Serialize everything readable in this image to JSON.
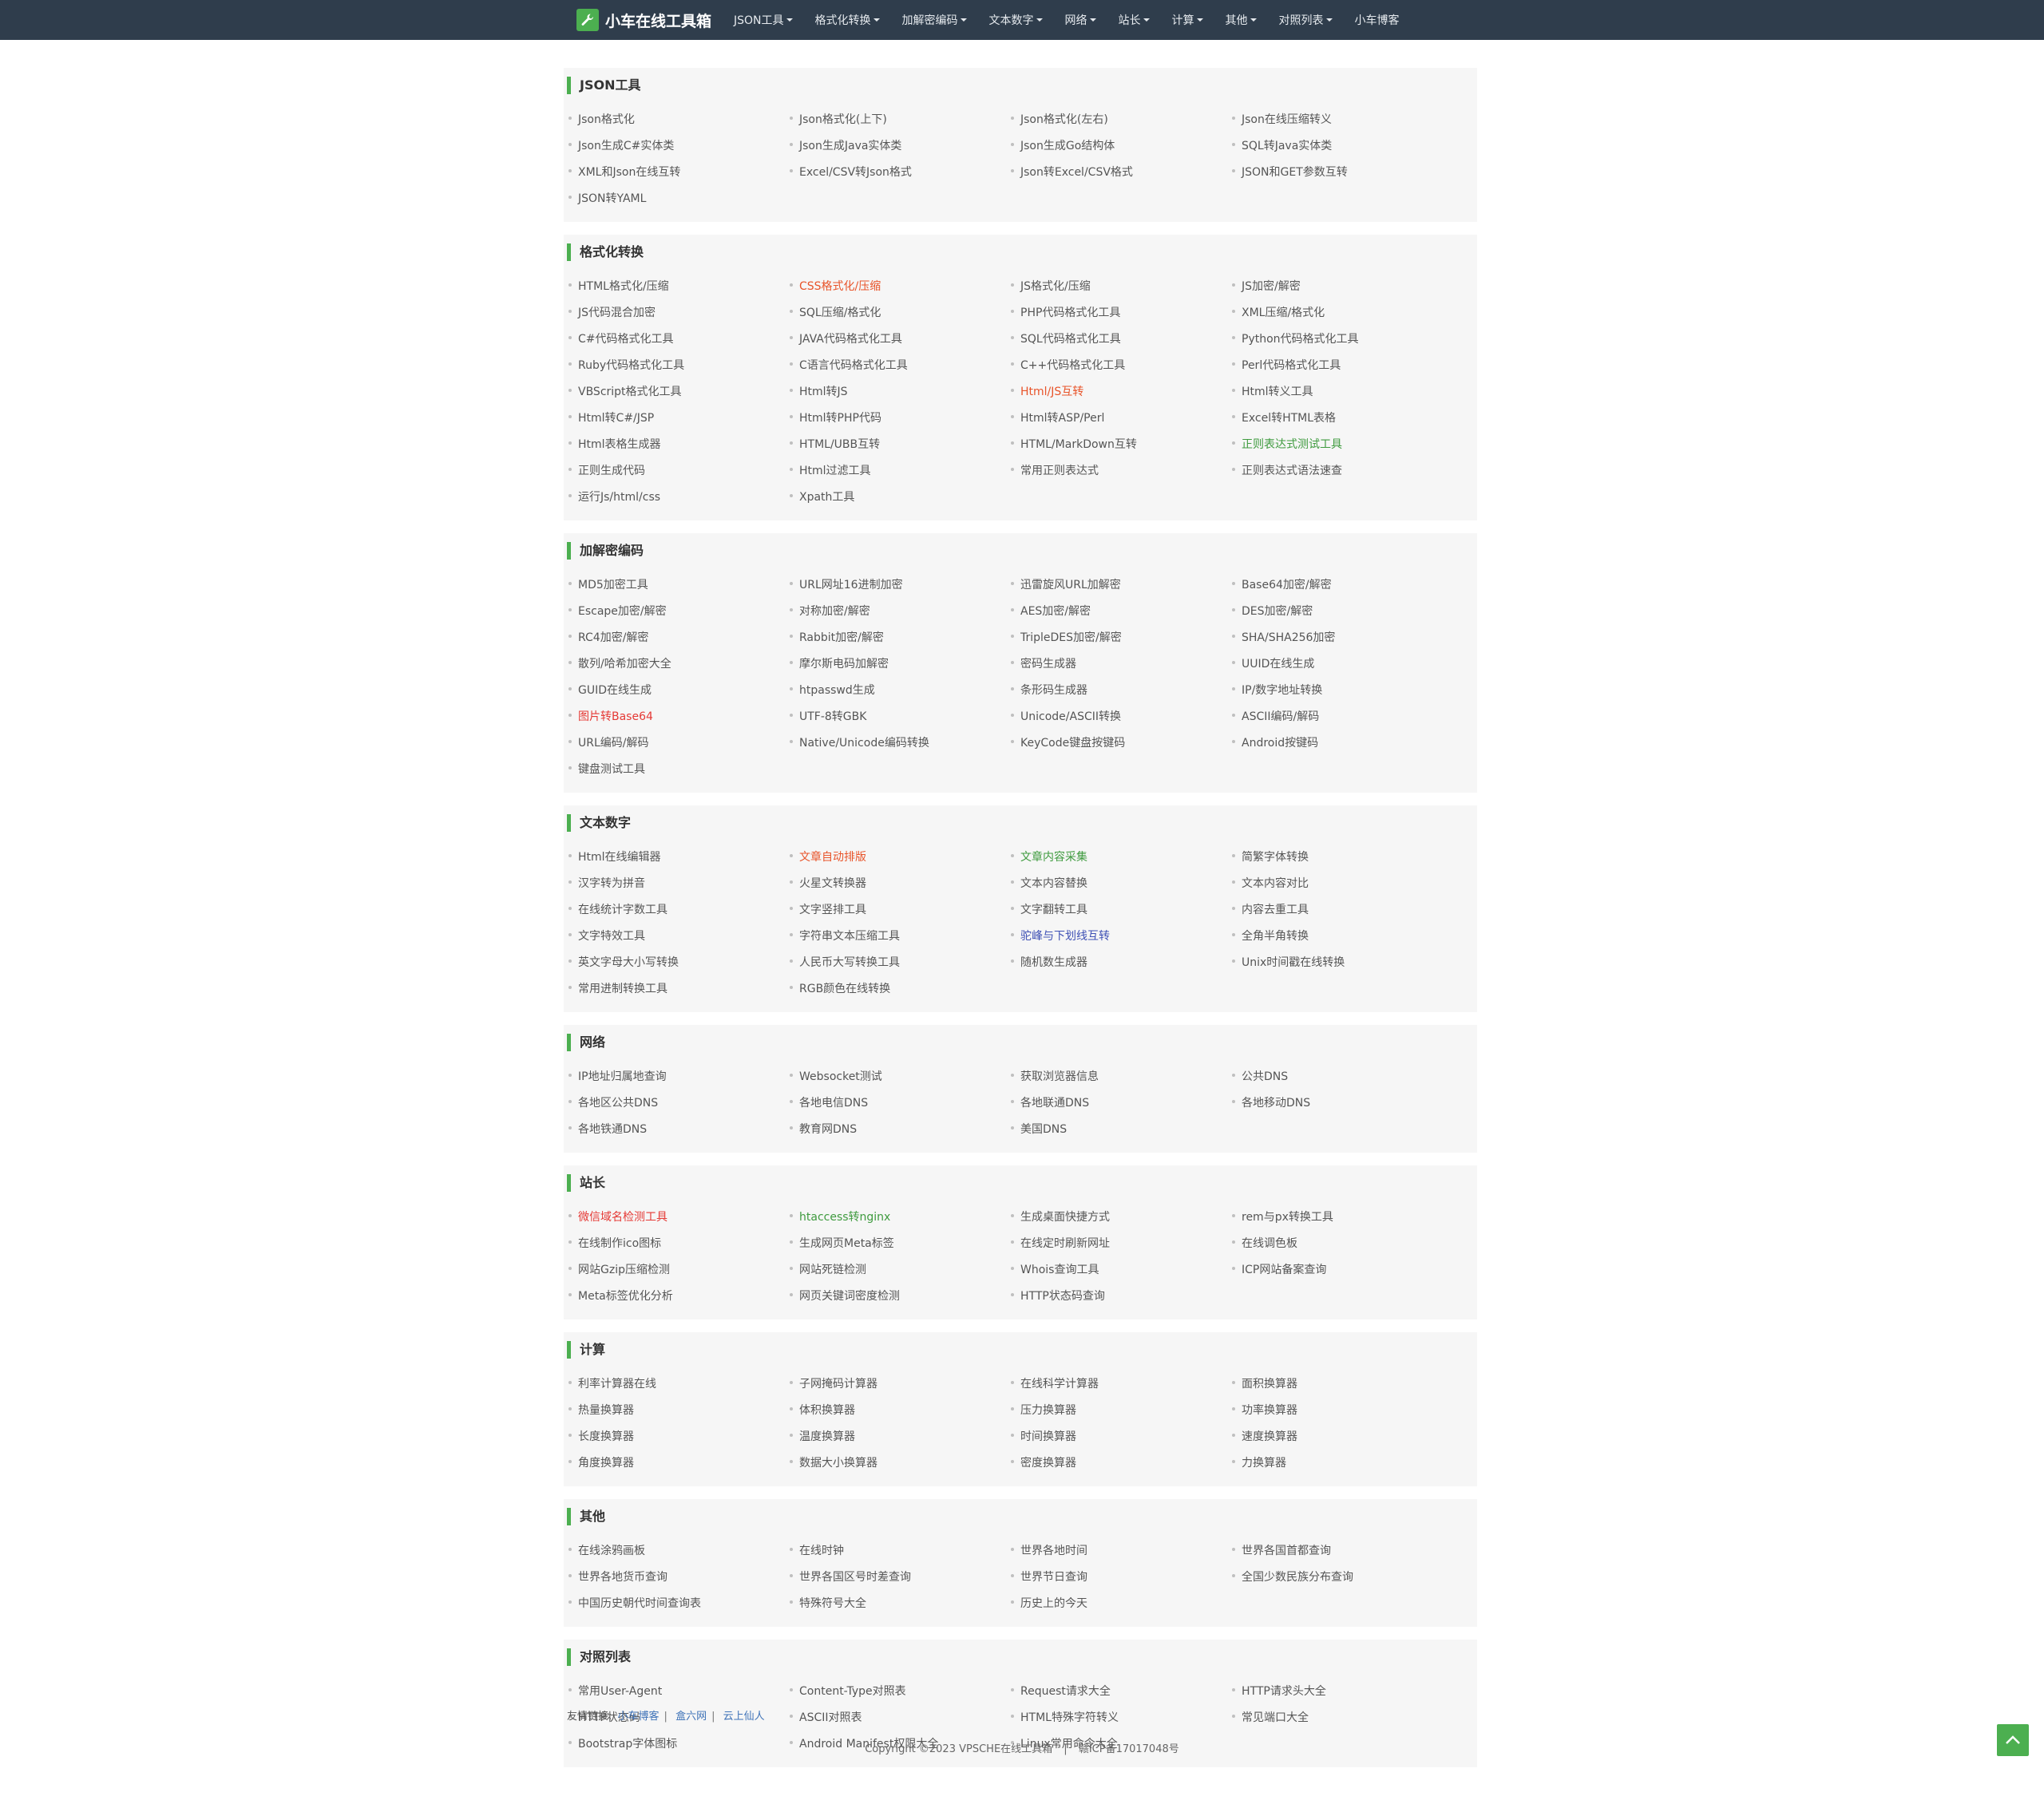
{
  "brand": {
    "name": "小车在线工具箱",
    "logo_icon": "wrench-icon"
  },
  "nav": [
    {
      "label": "JSON工具",
      "dropdown": true
    },
    {
      "label": "格式化转换",
      "dropdown": true
    },
    {
      "label": "加解密编码",
      "dropdown": true
    },
    {
      "label": "文本数字",
      "dropdown": true
    },
    {
      "label": "网络",
      "dropdown": true
    },
    {
      "label": "站长",
      "dropdown": true
    },
    {
      "label": "计算",
      "dropdown": true
    },
    {
      "label": "其他",
      "dropdown": true
    },
    {
      "label": "对照列表",
      "dropdown": true
    },
    {
      "label": "小车博客",
      "dropdown": false
    }
  ],
  "sections": [
    {
      "id": "json",
      "title": "JSON工具",
      "items": [
        {
          "label": "Json格式化"
        },
        {
          "label": "Json格式化(上下)"
        },
        {
          "label": "Json格式化(左右)"
        },
        {
          "label": "Json在线压缩转义"
        },
        {
          "label": "Json生成C#实体类"
        },
        {
          "label": "Json生成Java实体类"
        },
        {
          "label": "Json生成Go结构体"
        },
        {
          "label": "SQL转Java实体类"
        },
        {
          "label": "XML和Json在线互转"
        },
        {
          "label": "Excel/CSV转Json格式"
        },
        {
          "label": "Json转Excel/CSV格式"
        },
        {
          "label": "JSON和GET参数互转"
        },
        {
          "label": "JSON转YAML"
        }
      ]
    },
    {
      "id": "format",
      "title": "格式化转换",
      "items": [
        {
          "label": "HTML格式化/压缩"
        },
        {
          "label": "CSS格式化/压缩",
          "color": "orange"
        },
        {
          "label": "JS格式化/压缩"
        },
        {
          "label": "JS加密/解密"
        },
        {
          "label": "JS代码混合加密"
        },
        {
          "label": "SQL压缩/格式化"
        },
        {
          "label": "PHP代码格式化工具"
        },
        {
          "label": "XML压缩/格式化"
        },
        {
          "label": "C#代码格式化工具"
        },
        {
          "label": "JAVA代码格式化工具"
        },
        {
          "label": "SQL代码格式化工具"
        },
        {
          "label": "Python代码格式化工具"
        },
        {
          "label": "Ruby代码格式化工具"
        },
        {
          "label": "C语言代码格式化工具"
        },
        {
          "label": "C++代码格式化工具"
        },
        {
          "label": "Perl代码格式化工具"
        },
        {
          "label": "VBScript格式化工具"
        },
        {
          "label": "Html转JS"
        },
        {
          "label": "Html/JS互转",
          "color": "orange"
        },
        {
          "label": "Html转义工具"
        },
        {
          "label": "Html转C#/JSP"
        },
        {
          "label": "Html转PHP代码"
        },
        {
          "label": "Html转ASP/Perl"
        },
        {
          "label": "Excel转HTML表格"
        },
        {
          "label": "Html表格生成器"
        },
        {
          "label": "HTML/UBB互转"
        },
        {
          "label": "HTML/MarkDown互转"
        },
        {
          "label": "正则表达式测试工具",
          "color": "green"
        },
        {
          "label": "正则生成代码"
        },
        {
          "label": "Html过滤工具"
        },
        {
          "label": "常用正则表达式"
        },
        {
          "label": "正则表达式语法速查"
        },
        {
          "label": "运行Js/html/css"
        },
        {
          "label": "Xpath工具"
        }
      ]
    },
    {
      "id": "crypto",
      "title": "加解密编码",
      "items": [
        {
          "label": "MD5加密工具"
        },
        {
          "label": "URL网址16进制加密"
        },
        {
          "label": "迅雷旋风URL加解密"
        },
        {
          "label": "Base64加密/解密"
        },
        {
          "label": "Escape加密/解密"
        },
        {
          "label": "对称加密/解密"
        },
        {
          "label": "AES加密/解密"
        },
        {
          "label": "DES加密/解密"
        },
        {
          "label": "RC4加密/解密"
        },
        {
          "label": "Rabbit加密/解密"
        },
        {
          "label": "TripleDES加密/解密"
        },
        {
          "label": "SHA/SHA256加密"
        },
        {
          "label": "散列/哈希加密大全"
        },
        {
          "label": "摩尔斯电码加解密"
        },
        {
          "label": "密码生成器"
        },
        {
          "label": "UUID在线生成"
        },
        {
          "label": "GUID在线生成"
        },
        {
          "label": "htpasswd生成"
        },
        {
          "label": "条形码生成器"
        },
        {
          "label": "IP/数字地址转换"
        },
        {
          "label": "图片转Base64",
          "color": "red"
        },
        {
          "label": "UTF-8转GBK"
        },
        {
          "label": "Unicode/ASCII转换"
        },
        {
          "label": "ASCII编码/解码"
        },
        {
          "label": "URL编码/解码"
        },
        {
          "label": "Native/Unicode编码转换"
        },
        {
          "label": "KeyCode键盘按键码"
        },
        {
          "label": "Android按键码"
        },
        {
          "label": "键盘测试工具"
        }
      ]
    },
    {
      "id": "text",
      "title": "文本数字",
      "items": [
        {
          "label": "Html在线编辑器"
        },
        {
          "label": "文章自动排版",
          "color": "orange"
        },
        {
          "label": "文章内容采集",
          "color": "green"
        },
        {
          "label": "简繁字体转换"
        },
        {
          "label": "汉字转为拼音"
        },
        {
          "label": "火星文转换器"
        },
        {
          "label": "文本内容替换"
        },
        {
          "label": "文本内容对比"
        },
        {
          "label": "在线统计字数工具"
        },
        {
          "label": "文字竖排工具"
        },
        {
          "label": "文字翻转工具"
        },
        {
          "label": "内容去重工具"
        },
        {
          "label": "文字特效工具"
        },
        {
          "label": "字符串文本压缩工具"
        },
        {
          "label": "驼峰与下划线互转",
          "color": "blue"
        },
        {
          "label": "全角半角转换"
        },
        {
          "label": "英文字母大小写转换"
        },
        {
          "label": "人民币大写转换工具"
        },
        {
          "label": "随机数生成器"
        },
        {
          "label": "Unix时间戳在线转换"
        },
        {
          "label": "常用进制转换工具"
        },
        {
          "label": "RGB颜色在线转换"
        }
      ]
    },
    {
      "id": "network",
      "title": "网络",
      "items": [
        {
          "label": "IP地址归属地查询"
        },
        {
          "label": "Websocket测试"
        },
        {
          "label": "获取浏览器信息"
        },
        {
          "label": "公共DNS"
        },
        {
          "label": "各地区公共DNS"
        },
        {
          "label": "各地电信DNS"
        },
        {
          "label": "各地联通DNS"
        },
        {
          "label": "各地移动DNS"
        },
        {
          "label": "各地铁通DNS"
        },
        {
          "label": "教育网DNS"
        },
        {
          "label": "美国DNS"
        }
      ]
    },
    {
      "id": "webmaster",
      "title": "站长",
      "items": [
        {
          "label": "微信域名检测工具",
          "color": "red"
        },
        {
          "label": "htaccess转nginx",
          "color": "green"
        },
        {
          "label": "生成桌面快捷方式"
        },
        {
          "label": "rem与px转换工具"
        },
        {
          "label": "在线制作ico图标"
        },
        {
          "label": "生成网页Meta标签"
        },
        {
          "label": "在线定时刷新网址"
        },
        {
          "label": "在线调色板"
        },
        {
          "label": "网站Gzip压缩检测"
        },
        {
          "label": "网站死链检测"
        },
        {
          "label": "Whois查询工具"
        },
        {
          "label": "ICP网站备案查询"
        },
        {
          "label": "Meta标签优化分析"
        },
        {
          "label": "网页关键词密度检测"
        },
        {
          "label": "HTTP状态码查询"
        }
      ]
    },
    {
      "id": "calc",
      "title": "计算",
      "items": [
        {
          "label": "利率计算器在线"
        },
        {
          "label": "子网掩码计算器"
        },
        {
          "label": "在线科学计算器"
        },
        {
          "label": "面积换算器"
        },
        {
          "label": "热量换算器"
        },
        {
          "label": "体积换算器"
        },
        {
          "label": "压力换算器"
        },
        {
          "label": "功率换算器"
        },
        {
          "label": "长度换算器"
        },
        {
          "label": "温度换算器"
        },
        {
          "label": "时间换算器"
        },
        {
          "label": "速度换算器"
        },
        {
          "label": "角度换算器"
        },
        {
          "label": "数据大小换算器"
        },
        {
          "label": "密度换算器"
        },
        {
          "label": "力换算器"
        }
      ]
    },
    {
      "id": "other",
      "title": "其他",
      "items": [
        {
          "label": "在线涂鸦画板"
        },
        {
          "label": "在线时钟"
        },
        {
          "label": "世界各地时间"
        },
        {
          "label": "世界各国首都查询"
        },
        {
          "label": "世界各地货币查询"
        },
        {
          "label": "世界各国区号时差查询"
        },
        {
          "label": "世界节日查询"
        },
        {
          "label": "全国少数民族分布查询"
        },
        {
          "label": "中国历史朝代时间查询表"
        },
        {
          "label": "特殊符号大全"
        },
        {
          "label": "历史上的今天"
        }
      ]
    },
    {
      "id": "lists",
      "title": "对照列表",
      "items": [
        {
          "label": "常用User-Agent"
        },
        {
          "label": "Content-Type对照表"
        },
        {
          "label": "Request请求大全"
        },
        {
          "label": "HTTP请求头大全"
        },
        {
          "label": "HTTP状态码"
        },
        {
          "label": "ASCII对照表"
        },
        {
          "label": "HTML特殊字符转义"
        },
        {
          "label": "常见端口大全"
        },
        {
          "label": "Bootstrap字体图标"
        },
        {
          "label": "Android Manifest权限大全"
        },
        {
          "label": "Linux常用命令大全"
        }
      ]
    }
  ],
  "footer": {
    "friends_label": "友情链接:",
    "friends": [
      "小车博客",
      "盒六网",
      "云上仙人"
    ],
    "copyright": "Copyright ©2023 VPSCHE在线工具箱",
    "icp": "赣ICP备17017048号"
  },
  "back_to_top_icon": "chevron-up-icon",
  "colors": {
    "navbar": "#2f3d4c",
    "accent": "#4caf50",
    "red": "#e53935",
    "orange": "#e8542a",
    "green": "#3f9b3f",
    "blue": "#3f51b5"
  }
}
